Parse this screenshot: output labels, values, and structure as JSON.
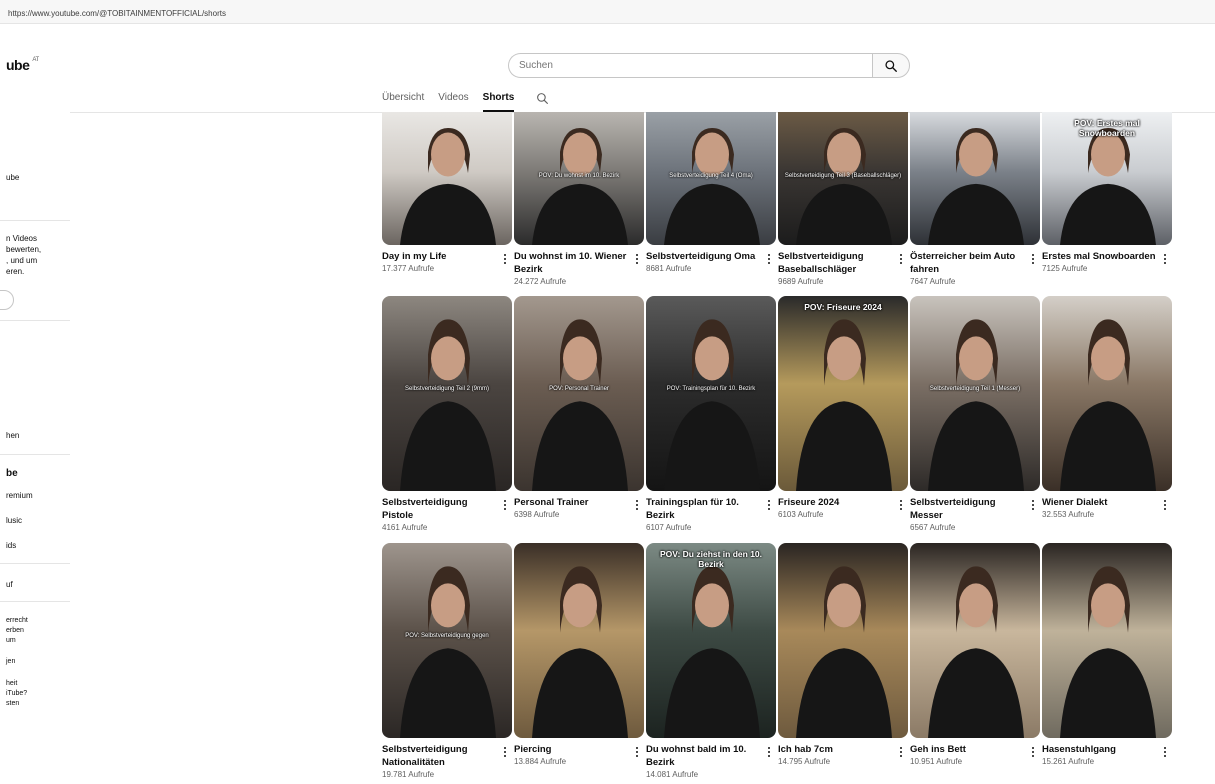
{
  "browser": {
    "url": "https://www.youtube.com/@TOBITAINMENTOFFICIAL/shorts"
  },
  "header": {
    "logo": "ube",
    "region": "AT",
    "search_placeholder": "Suchen"
  },
  "tabs": [
    "Übersicht",
    "Videos",
    "Shorts"
  ],
  "active_tab": "Shorts",
  "sidebar": {
    "items": [
      {
        "text": "ube",
        "style": "normal"
      },
      {
        "text": "n Videos",
        "style": "normal"
      },
      {
        "text": "bewerten,",
        "style": "normal"
      },
      {
        "text": ", und um",
        "style": "normal"
      },
      {
        "text": "eren.",
        "style": "normal"
      },
      {
        "text": "hen",
        "style": "normal"
      },
      {
        "text": "be",
        "style": "bold"
      },
      {
        "text": "remium",
        "style": "normal"
      },
      {
        "text": "lusic",
        "style": "normal"
      },
      {
        "text": "ids",
        "style": "normal"
      },
      {
        "text": "uf",
        "style": "normal"
      },
      {
        "text": "errecht",
        "style": "small"
      },
      {
        "text": "erben",
        "style": "small"
      },
      {
        "text": "um",
        "style": "small"
      },
      {
        "text": "jen",
        "style": "small"
      },
      {
        "text": "heit",
        "style": "small"
      },
      {
        "text": "iTube?",
        "style": "small"
      },
      {
        "text": "sten",
        "style": "small"
      }
    ]
  },
  "shorts": [
    {
      "title": "Day in my Life",
      "views": "17.377 Aufrufe",
      "overlay": ""
    },
    {
      "title": "Du wohnst im 10. Wiener Bezirk",
      "views": "24.272 Aufrufe",
      "overlay": "POV: Du wohnst im 10. Bezirk"
    },
    {
      "title": "Selbstverteidigung Oma",
      "views": "8681 Aufrufe",
      "overlay": "Selbstverteidigung Teil 4 (Oma)"
    },
    {
      "title": "Selbstverteidigung Baseballschläger",
      "views": "9689 Aufrufe",
      "overlay": "Selbstverteidigung Teil 3 (Baseballschläger)"
    },
    {
      "title": "Österreicher beim Auto fahren",
      "views": "7647 Aufrufe",
      "overlay": ""
    },
    {
      "title": "Erstes mal Snowboarden",
      "views": "7125 Aufrufe",
      "overlay": "POV: Erstes mal Snowboarden"
    },
    {
      "title": "Selbstverteidigung Pistole",
      "views": "4161 Aufrufe",
      "overlay": "Selbstverteidigung Teil 2 (9mm)"
    },
    {
      "title": "Personal Trainer",
      "views": "6398 Aufrufe",
      "overlay": "POV: Personal Trainer"
    },
    {
      "title": "Trainingsplan für 10. Bezirk",
      "views": "6107 Aufrufe",
      "overlay": "POV: Trainingsplan für 10. Bezirk"
    },
    {
      "title": "Friseure 2024",
      "views": "6103 Aufrufe",
      "overlay": "POV: Friseure 2024"
    },
    {
      "title": "Selbstverteidigung Messer",
      "views": "6567 Aufrufe",
      "overlay": "Selbstverteidigung Teil 1 (Messer)"
    },
    {
      "title": "Wiener Dialekt",
      "views": "32.553 Aufrufe",
      "overlay": ""
    },
    {
      "title": "Selbstverteidigung Nationalitäten",
      "views": "19.781 Aufrufe",
      "overlay": "POV: Selbstverteidigung gegen"
    },
    {
      "title": "Piercing",
      "views": "13.884 Aufrufe",
      "overlay": ""
    },
    {
      "title": "Du wohnst bald im 10. Bezirk",
      "views": "14.081 Aufrufe",
      "overlay": "POV: Du ziehst in den 10. Bezirk"
    },
    {
      "title": "Ich hab 7cm",
      "views": "14.795 Aufrufe",
      "overlay": ""
    },
    {
      "title": "Geh ins Bett",
      "views": "10.951 Aufrufe",
      "overlay": ""
    },
    {
      "title": "Hasenstuhlgang",
      "views": "15.261 Aufrufe",
      "overlay": ""
    }
  ]
}
